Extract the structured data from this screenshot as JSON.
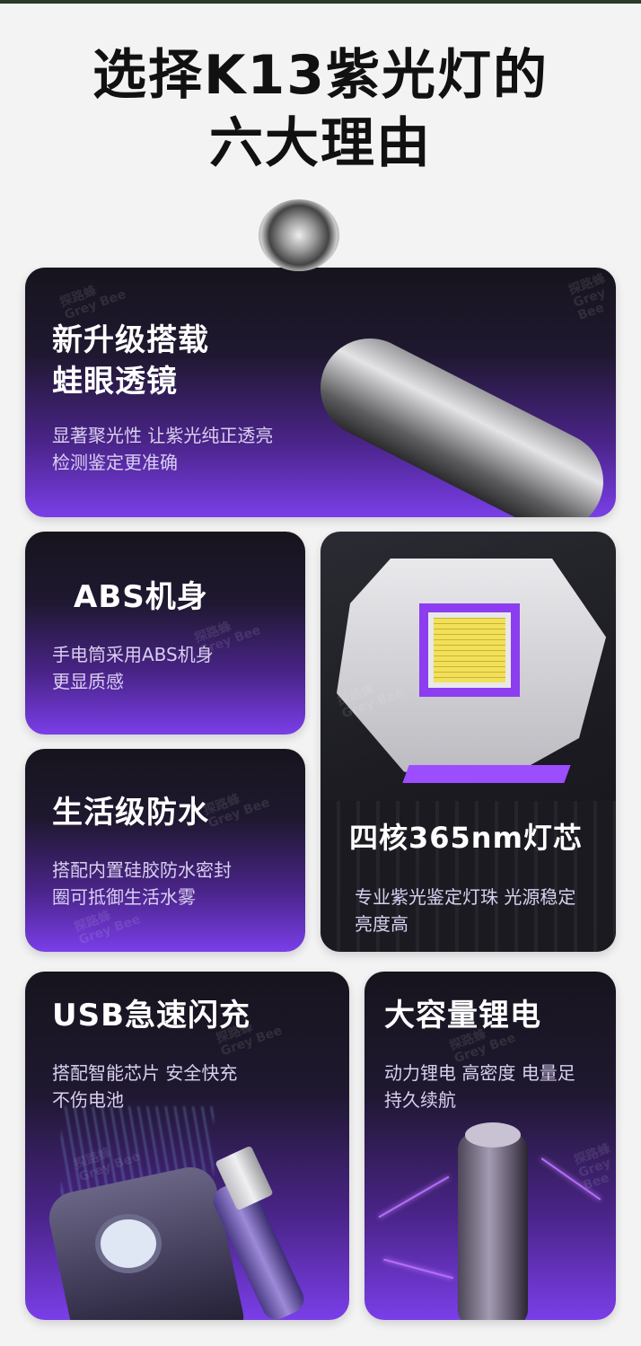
{
  "title": {
    "line1": "选择K13紫光灯的",
    "line2": "六大理由"
  },
  "watermark": {
    "cn": "探路蜂",
    "en": "Grey Bee"
  },
  "features": [
    {
      "head_line1": "新升级搭载",
      "head_line2": "蛙眼透镜",
      "desc_line1": "显著聚光性 让紫光纯正透亮",
      "desc_line2": "检测鉴定更准确"
    },
    {
      "head": "ABS机身",
      "desc_line1": "手电筒采用ABS机身",
      "desc_line2": "更显质感"
    },
    {
      "head": "生活级防水",
      "desc_line1": "搭配内置硅胶防水密封",
      "desc_line2": "圈可抵御生活水雾"
    },
    {
      "head": "四核365nm灯芯",
      "desc_line1": "专业紫光鉴定灯珠 光源稳定",
      "desc_line2": "亮度高"
    },
    {
      "head": "USB急速闪充",
      "desc_line1": "搭配智能芯片 安全快充",
      "desc_line2": "不伤电池"
    },
    {
      "head": "大容量锂电",
      "desc_line1": "动力锂电 高密度 电量足",
      "desc_line2": "持久续航"
    }
  ],
  "colors": {
    "accent_purple": "#7a3ee8",
    "card_dark": "#17141d"
  }
}
